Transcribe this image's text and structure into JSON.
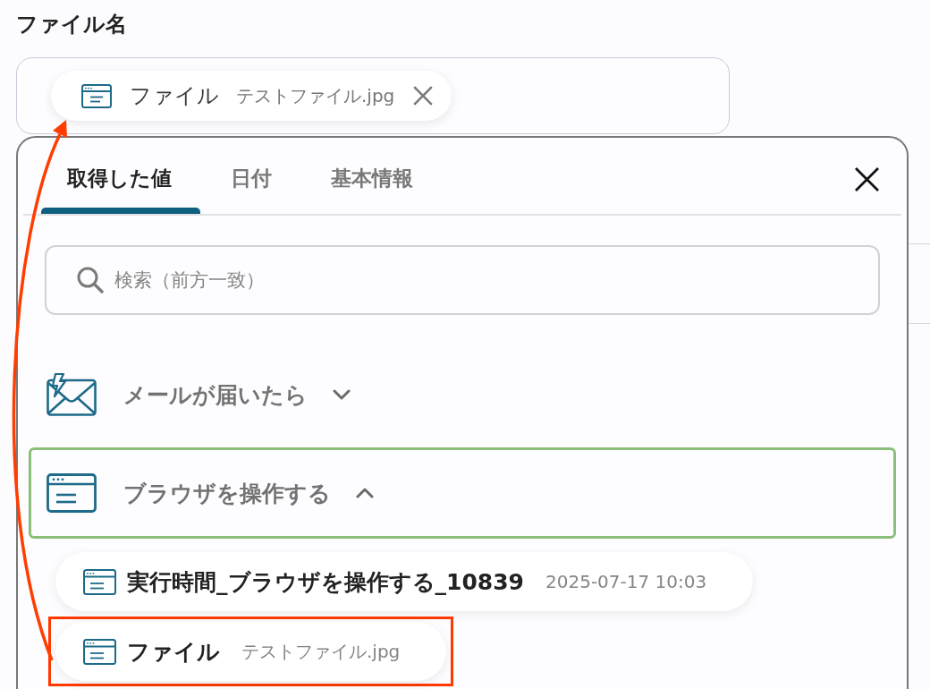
{
  "field": {
    "label": "ファイル名",
    "token": {
      "name": "ファイル",
      "value": "テストファイル.jpg"
    }
  },
  "picker": {
    "tabs": [
      {
        "label": "取得した値",
        "selected": true
      },
      {
        "label": "日付",
        "selected": false
      },
      {
        "label": "基本情報",
        "selected": false
      }
    ],
    "search": {
      "placeholder": "検索（前方一致）"
    },
    "groups": [
      {
        "kind": "mail",
        "title": "メールが届いたら",
        "selected": false,
        "expanded": false
      },
      {
        "kind": "browser",
        "title": "ブラウザを操作する",
        "selected": true,
        "expanded": true,
        "items": [
          {
            "name": "実行時間_ブラウザを操作する_10839",
            "value": "2025-07-17 10:03",
            "highlighted": false
          },
          {
            "name": "ファイル",
            "value": "テストファイル.jpg",
            "highlighted": true
          }
        ]
      }
    ]
  }
}
